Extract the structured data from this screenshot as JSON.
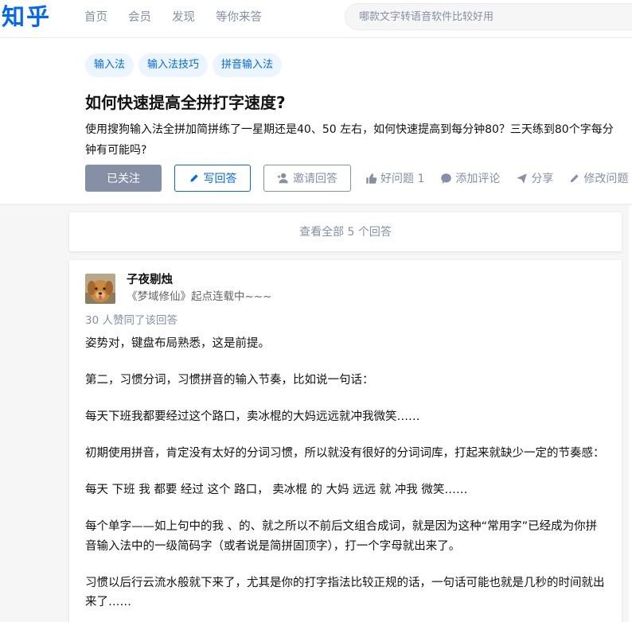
{
  "topbar": {
    "logo": "知乎",
    "nav": [
      "首页",
      "会员",
      "发现",
      "等你来答"
    ],
    "search_placeholder": "哪款文字转语音软件比较好用"
  },
  "question": {
    "tags": [
      "输入法",
      "输入法技巧",
      "拼音输入法"
    ],
    "title": "如何快速提高全拼打字速度?",
    "description": "使用搜狗输入法全拼加简拼练了一星期还是40、50 左右，如何快速提高到每分钟80？三天练到80个字每分钟有可能吗?",
    "actions": {
      "follow": "已关注",
      "write_answer": "写回答",
      "invite": "邀请回答",
      "good_question": "好问题 1",
      "comment": "添加评论",
      "share": "分享",
      "edit": "修改问题"
    }
  },
  "view_all": "查看全部 5 个回答",
  "answer": {
    "author_name": "子夜剔烛",
    "author_bio": "《梦域修仙》起点连载中~~~",
    "votes": "30 人赞同了该回答",
    "paragraphs": [
      "姿势对，键盘布局熟悉，这是前提。",
      "第二，习惯分词，习惯拼音的输入节奏，比如说一句话：",
      "每天下班我都要经过这个路口，卖冰棍的大妈远远就冲我微笑……",
      "初期使用拼音，肯定没有太好的分词习惯，所以就没有很好的分词词库，打起来就缺少一定的节奏感：",
      "每天 下班 我 都要 经过 这个 路口， 卖冰棍 的 大妈 远远 就 冲我 微笑……",
      "每个单字——如上句中的我 、的、就之所以不前后文组合成词，就是因为这种“常用字”已经成为你拼音输入法中的一级简码字（或者说是简拼固顶字），打一个字母就出来了。",
      "习惯以后行云流水般就下来了，尤其是你的打字指法比较正规的话，一句话可能也就是几秒的时间就出来了……"
    ]
  },
  "colors": {
    "brand": "#0066ff",
    "muted": "#8590a6",
    "tag_bg": "#ebf5ff"
  },
  "icons": [
    "pencil-icon",
    "invite-user-icon",
    "thumb-up-icon",
    "comment-icon",
    "share-icon",
    "edit-pencil-icon",
    "dog-avatar"
  ]
}
